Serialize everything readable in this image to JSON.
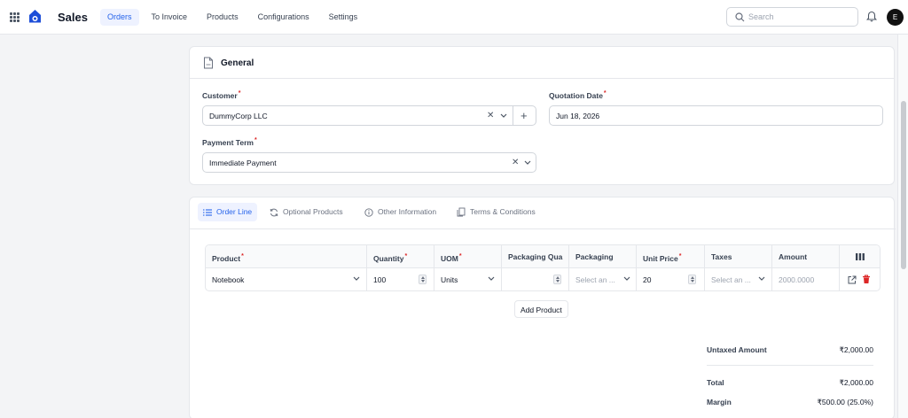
{
  "header": {
    "app_title": "Sales",
    "nav": [
      "Orders",
      "To Invoice",
      "Products",
      "Configurations",
      "Settings"
    ],
    "active_nav": "Orders",
    "search_placeholder": "Search",
    "avatar_initial": "E"
  },
  "general": {
    "title": "General",
    "customer_label": "Customer",
    "customer_value": "DummyCorp LLC",
    "quotation_date_label": "Quotation Date",
    "quotation_date_value": "Jun 18, 2026",
    "payment_term_label": "Payment Term",
    "payment_term_value": "Immediate Payment"
  },
  "tabs": [
    "Order Line",
    "Optional Products",
    "Other Information",
    "Terms & Conditions"
  ],
  "order_lines": {
    "columns": [
      "Product",
      "Quantity",
      "UOM",
      "Packaging Qua",
      "Packaging",
      "Unit Price",
      "Taxes",
      "Amount"
    ],
    "required_columns": [
      "Product",
      "Quantity",
      "UOM",
      "Unit Price"
    ],
    "row": {
      "product": "Notebook",
      "quantity": "100",
      "uom": "Units",
      "packaging_qty": "",
      "packaging_placeholder": "Select an ...",
      "unit_price": "20",
      "taxes_placeholder": "Select an ...",
      "amount": "2000.0000"
    },
    "add_product_label": "Add Product"
  },
  "totals": {
    "untaxed_label": "Untaxed Amount",
    "untaxed_value": "₹2,000.00",
    "total_label": "Total",
    "total_value": "₹2,000.00",
    "margin_label": "Margin",
    "margin_value": "₹500.00 (25.0%)"
  },
  "colors": {
    "accent": "#2563eb",
    "required": "#dc2626",
    "delete": "#dc2626"
  }
}
